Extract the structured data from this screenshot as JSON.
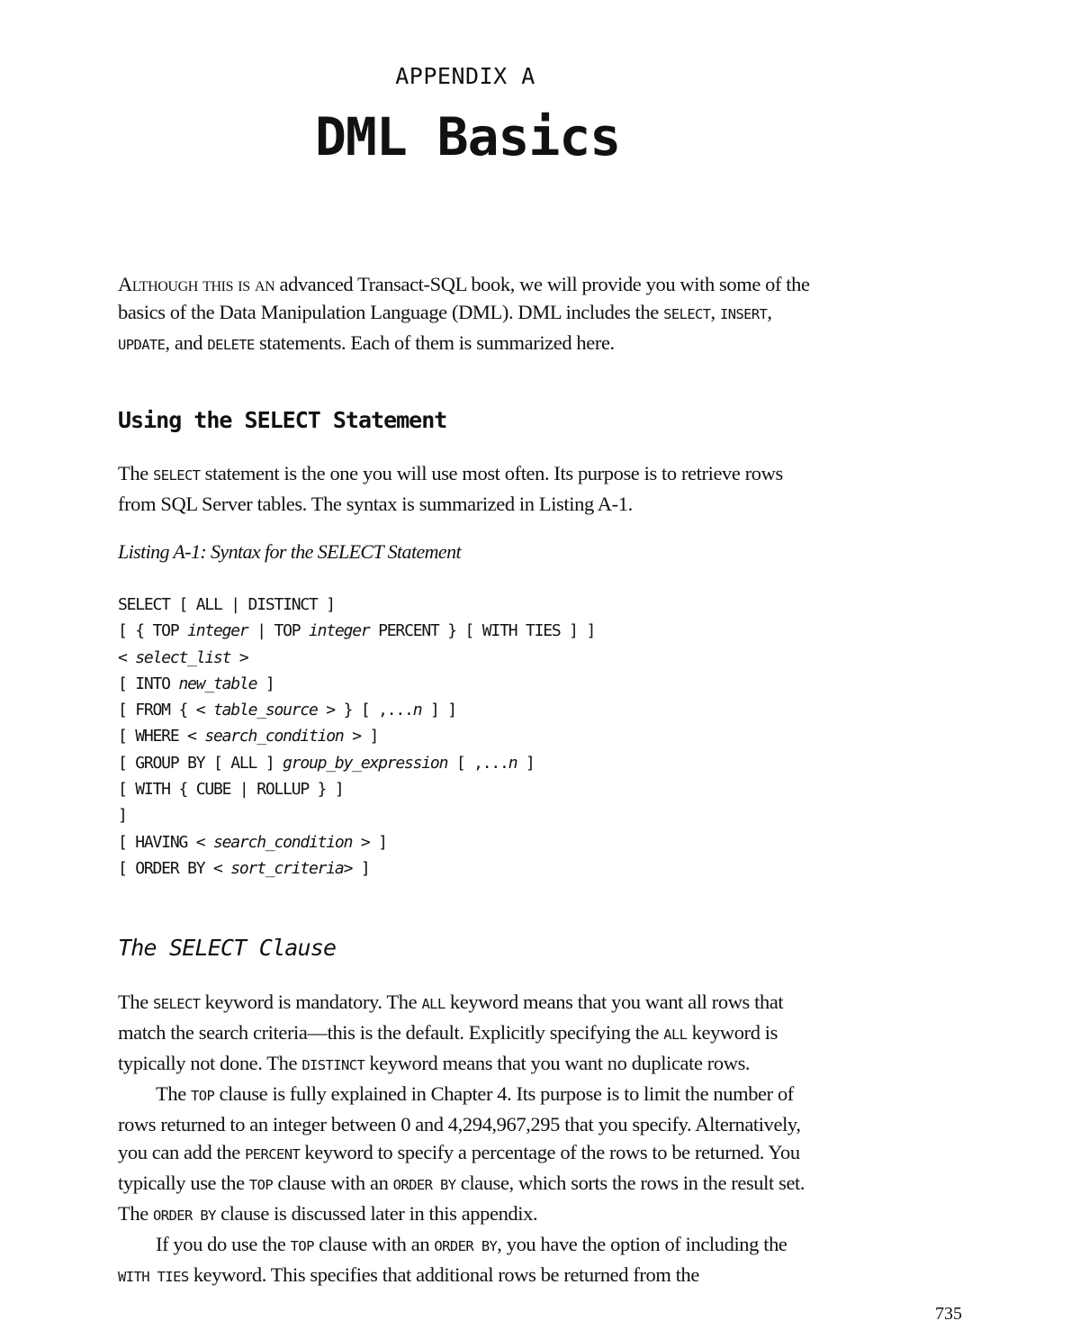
{
  "header": {
    "appendix_label": "APPENDIX A",
    "title": "DML Basics"
  },
  "intro": {
    "lead_smallcaps": "Although this is an",
    "segments": [
      {
        "t": " advanced Transact-SQL book, we will provide you with some of the basics of the Data Manipulation Language (DML). DML includes the "
      },
      {
        "c": "SELECT"
      },
      {
        "t": ", "
      },
      {
        "c": "INSERT"
      },
      {
        "t": ", "
      },
      {
        "c": "UPDATE"
      },
      {
        "t": ", and "
      },
      {
        "c": "DELETE"
      },
      {
        "t": " statements. Each of them is summarized here."
      }
    ]
  },
  "section_select": {
    "heading": "Using the SELECT Statement",
    "paragraph": [
      {
        "t": "The "
      },
      {
        "c": "SELECT"
      },
      {
        "t": " statement is the one you will use most often. Its purpose is to retrieve rows from SQL Server tables. The syntax is summarized in Listing A-1."
      }
    ],
    "listing_caption": "Listing A-1: Syntax for the SELECT Statement",
    "listing_lines": [
      [
        {
          "k": "SELECT [ ALL | DISTINCT ]"
        }
      ],
      [
        {
          "k": "[ { TOP "
        },
        {
          "i": "integer"
        },
        {
          "k": " | TOP "
        },
        {
          "i": "integer"
        },
        {
          "k": " PERCENT } [ WITH TIES ] ]"
        }
      ],
      [
        {
          "k": "< "
        },
        {
          "i": "select_list"
        },
        {
          "k": " >"
        }
      ],
      [
        {
          "k": "[ INTO "
        },
        {
          "i": "new_table"
        },
        {
          "k": " ]"
        }
      ],
      [
        {
          "k": "[ FROM { < "
        },
        {
          "i": "table_source"
        },
        {
          "k": " > } [ ,..."
        },
        {
          "i": "n"
        },
        {
          "k": " ] ]"
        }
      ],
      [
        {
          "k": "[ WHERE < "
        },
        {
          "i": "search_condition"
        },
        {
          "k": " > ]"
        }
      ],
      [
        {
          "k": "[ GROUP BY [ ALL ] "
        },
        {
          "i": "group_by_expression"
        },
        {
          "k": " [ ,..."
        },
        {
          "i": "n"
        },
        {
          "k": " ]"
        }
      ],
      [
        {
          "k": "[ WITH { CUBE | ROLLUP } ]"
        }
      ],
      [
        {
          "k": "]"
        }
      ],
      [
        {
          "k": "[ HAVING < "
        },
        {
          "i": "search_condition"
        },
        {
          "k": " > ]"
        }
      ],
      [
        {
          "k": "[ ORDER BY < "
        },
        {
          "i": "sort_criteria"
        },
        {
          "k": "> ]"
        }
      ]
    ]
  },
  "section_clause": {
    "heading": "The SELECT Clause",
    "paragraphs": [
      [
        {
          "t": "The "
        },
        {
          "c": "SELECT"
        },
        {
          "t": " keyword is mandatory. The "
        },
        {
          "c": "ALL"
        },
        {
          "t": " keyword means that you want all rows that match the search criteria—this is the default. Explicitly specifying the "
        },
        {
          "c": "ALL"
        },
        {
          "t": " keyword is typically not done. The "
        },
        {
          "c": "DISTINCT"
        },
        {
          "t": " keyword means that you want no duplicate rows."
        }
      ],
      [
        {
          "t": "The "
        },
        {
          "c": "TOP"
        },
        {
          "t": " clause is fully explained in Chapter 4. Its purpose is to limit the num­ber of rows returned to an integer between 0 and 4,294,967,295 that you specify. Alternatively, you can add the "
        },
        {
          "c": "PERCENT"
        },
        {
          "t": " keyword to specify a percentage of the rows to be returned. You typically use the "
        },
        {
          "c": "TOP"
        },
        {
          "t": " clause with an "
        },
        {
          "c": "ORDER BY"
        },
        {
          "t": " clause, which sorts the rows in the result set. The "
        },
        {
          "c": "ORDER BY"
        },
        {
          "t": " clause is discussed later in this appendix."
        }
      ],
      [
        {
          "t": "If you do use the "
        },
        {
          "c": "TOP"
        },
        {
          "t": " clause with an "
        },
        {
          "c": "ORDER BY"
        },
        {
          "t": ", you have the option of including the "
        },
        {
          "c": "WITH TIES"
        },
        {
          "t": " keyword. This specifies that additional rows be returned from the"
        }
      ]
    ]
  },
  "footer": {
    "page_number": "735"
  }
}
